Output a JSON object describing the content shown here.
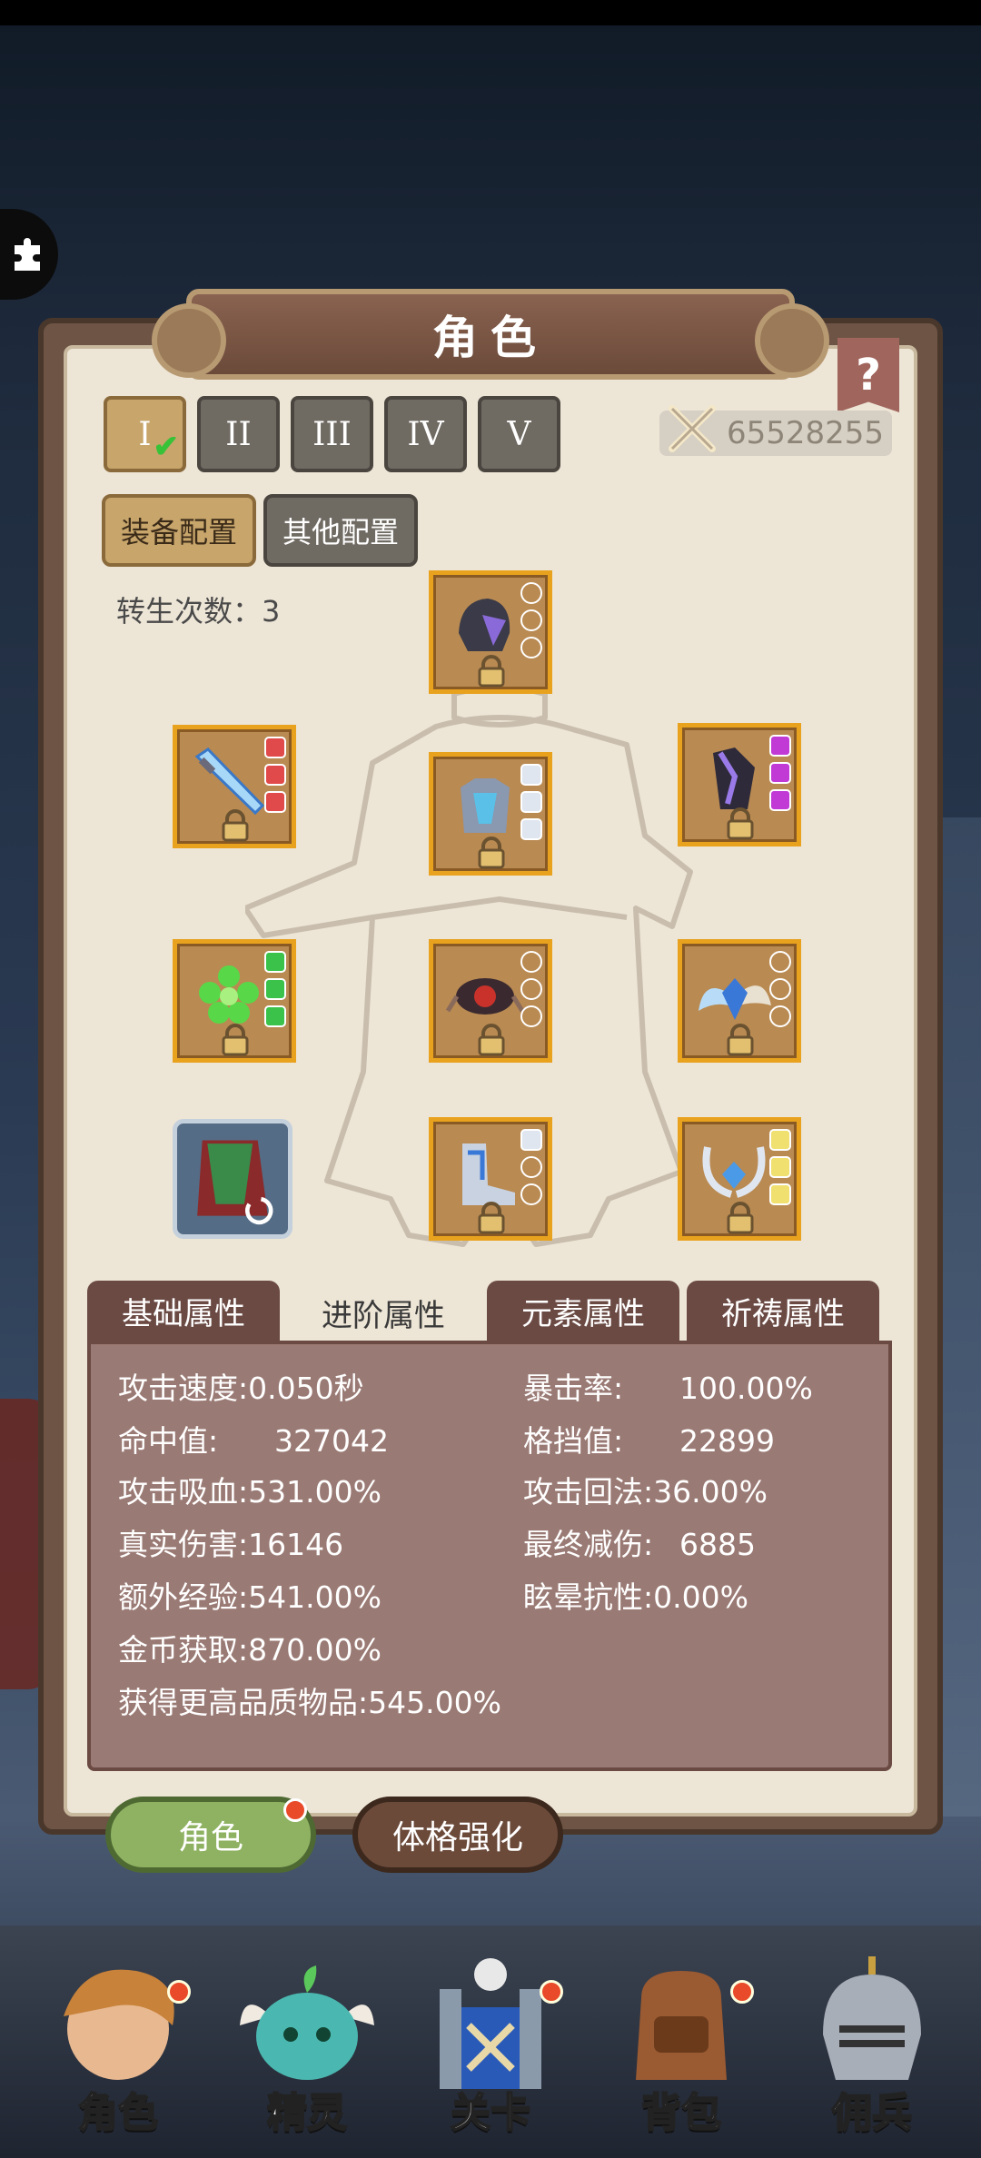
{
  "title": "角色",
  "help": "?",
  "tiers": [
    {
      "label": "I",
      "active": true,
      "checked": true
    },
    {
      "label": "II",
      "active": false
    },
    {
      "label": "III",
      "active": false
    },
    {
      "label": "IV",
      "active": false
    },
    {
      "label": "V",
      "active": false
    }
  ],
  "power": {
    "value": "65528255",
    "icon": "crossed-swords-icon"
  },
  "config": {
    "equip": "装备配置",
    "other": "其他配置"
  },
  "rebirth": "转生次数：3",
  "slots": {
    "helmet": {
      "gems": [
        "#e6eef8",
        "#e6eef8",
        "#e6eef8"
      ],
      "gem_shape": "round"
    },
    "weapon": {
      "gems": [
        "#e14a4a",
        "#e14a4a",
        "#e14a4a"
      ]
    },
    "armor": {
      "gems": [
        "#dfe6f0",
        "#dfe6f0",
        "#dfe6f0"
      ]
    },
    "gloves": {
      "gems": [
        "#c13ad6",
        "#c13ad6",
        "#c13ad6"
      ]
    },
    "ring": {
      "gems": [
        "#3ac24a",
        "#3ac24a",
        "#3ac24a"
      ]
    },
    "belt": {
      "gems": [
        "#e6eef8",
        "#e6eef8",
        "#e6eef8"
      ],
      "gem_shape": "round"
    },
    "wings": {
      "gems": [
        "#e6eef8",
        "#e6eef8",
        "#e6eef8"
      ],
      "gem_shape": "round"
    },
    "boots": {
      "gems": [
        "#dfe6f0",
        "#dfe6f0",
        "#dfe6f0"
      ]
    },
    "necklace": {
      "gems": [
        "#f0e070",
        "#f0e070",
        "#f0e070"
      ]
    }
  },
  "attr_tabs": [
    "基础属性",
    "进阶属性",
    "元素属性",
    "祈祷属性"
  ],
  "attr_active": 1,
  "stats_left": [
    {
      "label": "攻击速度:",
      "value": "0.050秒"
    },
    {
      "label": "命中值:",
      "value": "327042"
    },
    {
      "label": "攻击吸血:",
      "value": "531.00%"
    },
    {
      "label": "真实伤害:",
      "value": "16146"
    },
    {
      "label": "额外经验:",
      "value": "541.00%"
    },
    {
      "label": "金币获取:",
      "value": "870.00%"
    },
    {
      "label": "获得更高品质物品:",
      "value": "545.00%"
    }
  ],
  "stats_right": [
    {
      "label": "暴击率:",
      "value": "100.00%"
    },
    {
      "label": "格挡值:",
      "value": "22899"
    },
    {
      "label": "攻击回法:",
      "value": "36.00%"
    },
    {
      "label": "最终减伤:",
      "value": "6885"
    },
    {
      "label": "眩晕抗性:",
      "value": "0.00%"
    }
  ],
  "bottom_tabs": {
    "role": "角色",
    "body": "体格强化"
  },
  "nav": [
    {
      "label": "角色",
      "icon": "hero-portrait-icon",
      "dot": true
    },
    {
      "label": "精灵",
      "icon": "spirit-icon",
      "dot": false
    },
    {
      "label": "关卡",
      "icon": "stage-gate-icon",
      "dot": true
    },
    {
      "label": "背包",
      "icon": "backpack-icon",
      "dot": true
    },
    {
      "label": "佣兵",
      "icon": "knight-helmet-icon",
      "dot": false
    }
  ]
}
